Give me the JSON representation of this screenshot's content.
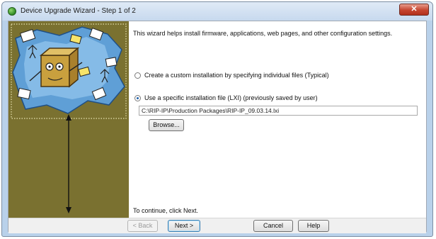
{
  "window": {
    "title": "Device Upgrade Wizard - Step 1 of 2",
    "close_glyph": "✕"
  },
  "main": {
    "intro": "This wizard helps install firmware, applications, web pages, and other configuration settings.",
    "option_custom": "Create a custom installation by specifying individual files (Typical)",
    "option_file": "Use a specific installation file (LXI) (previously saved by user)",
    "file_path": "C:\\RIP-IP\\Production Packages\\RIP-IP_09.03.14.lxi",
    "browse_label": "Browse...",
    "continue_text": "To continue, click Next."
  },
  "footer": {
    "back_label": "< Back",
    "next_label": "Next >",
    "cancel_label": "Cancel",
    "help_label": "Help"
  },
  "colors": {
    "side_panel": "#7a7130",
    "title_close": "#c6452f",
    "radio_selected": "#1e5faa"
  },
  "icons": {
    "app": "green-globe-icon",
    "side": "upgrade-collage-illustration"
  }
}
